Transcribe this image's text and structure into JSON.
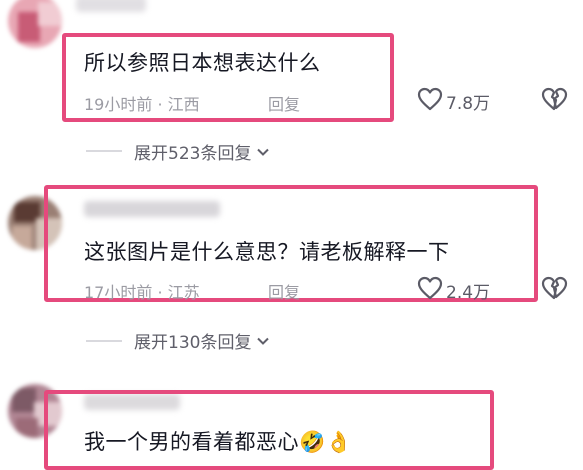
{
  "comments": [
    {
      "text": "所以参照日本想表达什么",
      "time": "19小时前",
      "location": "江西",
      "reply_label": "回复",
      "likes": "7.8万",
      "expand_label": "展开523条回复"
    },
    {
      "text": "这张图片是什么意思？请老板解释一下",
      "time": "17小时前",
      "location": "江苏",
      "reply_label": "回复",
      "likes": "2.4万",
      "expand_label": "展开130条回复"
    },
    {
      "text": "我一个男的看着都恶心🤣👌"
    }
  ],
  "colors": {
    "highlight": "#e54a7d",
    "meta": "#9b9ba3",
    "text": "#161823"
  },
  "icons": [
    "heart-icon",
    "dislike-heart-icon",
    "chevron-down-icon"
  ]
}
